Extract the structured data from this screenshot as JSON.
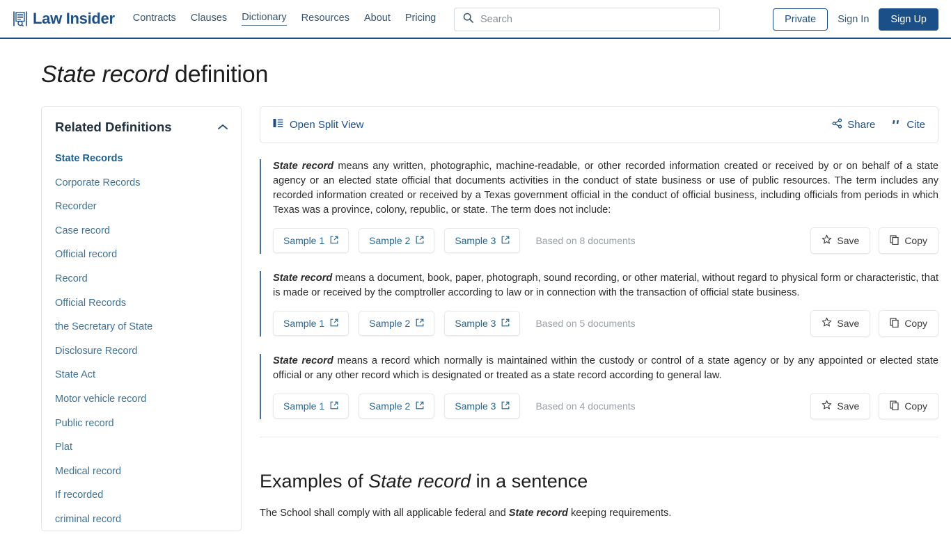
{
  "header": {
    "logo_text": "Law Insider",
    "logo_icon": "document-search-icon",
    "nav": [
      {
        "label": "Contracts",
        "active": false
      },
      {
        "label": "Clauses",
        "active": false
      },
      {
        "label": "Dictionary",
        "active": true
      },
      {
        "label": "Resources",
        "active": false
      },
      {
        "label": "About",
        "active": false
      },
      {
        "label": "Pricing",
        "active": false
      }
    ],
    "search": {
      "placeholder": "Search",
      "value": "",
      "icon": "search-icon"
    },
    "private_label": "Private",
    "signin_label": "Sign In",
    "signup_label": "Sign Up",
    "accent_color": "#1b4f87"
  },
  "page": {
    "title_term": "State record",
    "title_suffix": " definition"
  },
  "sidebar": {
    "title": "Related Definitions",
    "collapse_icon": "chevron-up-icon",
    "items": [
      {
        "label": "State Records",
        "current": true
      },
      {
        "label": "Corporate Records",
        "current": false
      },
      {
        "label": "Recorder",
        "current": false
      },
      {
        "label": "Case record",
        "current": false
      },
      {
        "label": "Official record",
        "current": false
      },
      {
        "label": "Record",
        "current": false
      },
      {
        "label": "Official Records",
        "current": false
      },
      {
        "label": "the Secretary of State",
        "current": false
      },
      {
        "label": "Disclosure Record",
        "current": false
      },
      {
        "label": "State Act",
        "current": false
      },
      {
        "label": "Motor vehicle record",
        "current": false
      },
      {
        "label": "Public record",
        "current": false
      },
      {
        "label": "Plat",
        "current": false
      },
      {
        "label": "Medical record",
        "current": false
      },
      {
        "label": "If recorded",
        "current": false
      },
      {
        "label": "criminal record",
        "current": false
      }
    ]
  },
  "toolbar": {
    "split_view_label": "Open Split View",
    "split_view_icon": "split-view-icon",
    "share_label": "Share",
    "share_icon": "share-icon",
    "cite_label": "Cite",
    "cite_icon": "quote-icon"
  },
  "definitions": [
    {
      "term": "State record",
      "text": " means any written, photographic, machine-readable, or other recorded information created or received by or on behalf of a state agency or an elected state official that documents activities in the conduct of state business or use of public resources. The term includes any recorded information created or received by a Texas government official in the conduct of official business, including officials from periods in which Texas was a province, colony, republic, or state. The term does not include:",
      "samples": [
        "Sample 1",
        "Sample 2",
        "Sample 3"
      ],
      "based_on": "Based on 8 documents",
      "save_label": "Save",
      "copy_label": "Copy"
    },
    {
      "term": "State record",
      "text": " means a document, book, paper, photograph, sound recording, or other material, without regard to physical form or characteristic, that is made or received by the comptroller according to law or in connection with the transaction of official state business.",
      "samples": [
        "Sample 1",
        "Sample 2",
        "Sample 3"
      ],
      "based_on": "Based on 5 documents",
      "save_label": "Save",
      "copy_label": "Copy"
    },
    {
      "term": "State record",
      "text": " means a record which normally is maintained within the custody or control of a state agency or by any appointed or elected state official or any other record which is designated or treated as a state record according to general law.",
      "samples": [
        "Sample 1",
        "Sample 2",
        "Sample 3"
      ],
      "based_on": "Based on 4 documents",
      "save_label": "Save",
      "copy_label": "Copy"
    }
  ],
  "examples": {
    "heading_prefix": "Examples of ",
    "heading_term": "State record",
    "heading_suffix": " in a sentence",
    "first_line_prefix": "The School shall comply with all applicable federal and ",
    "first_line_term": "State record",
    "first_line_suffix": " keeping requirements."
  }
}
